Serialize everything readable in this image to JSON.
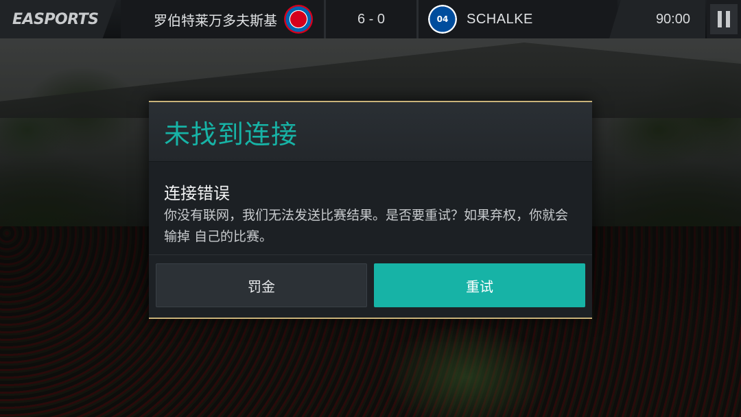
{
  "topbar": {
    "logo": "EASPORTS",
    "home_team": "罗伯特莱万多夫斯基",
    "home_crest_icon": "fc-bayern-crest-icon",
    "score": "6 - 0",
    "away_team": "SCHALKE",
    "away_crest_icon": "schalke-04-crest-icon",
    "away_crest_text": "04",
    "clock": "90:00",
    "pause_icon": "pause-icon"
  },
  "dialog": {
    "title": "未找到连接",
    "heading": "连接错误",
    "message": "你没有联网，我们无法发送比赛结果。是否要重试？如果弃权，你就会输掉 自己的比赛。",
    "buttons": {
      "fine_label": "罚金",
      "retry_label": "重试"
    }
  },
  "colors": {
    "accent": "#17b3a6",
    "dialog_border": "#c9b37a",
    "dialog_bg": "#1d2125",
    "topbar_bg": "#17191c"
  }
}
